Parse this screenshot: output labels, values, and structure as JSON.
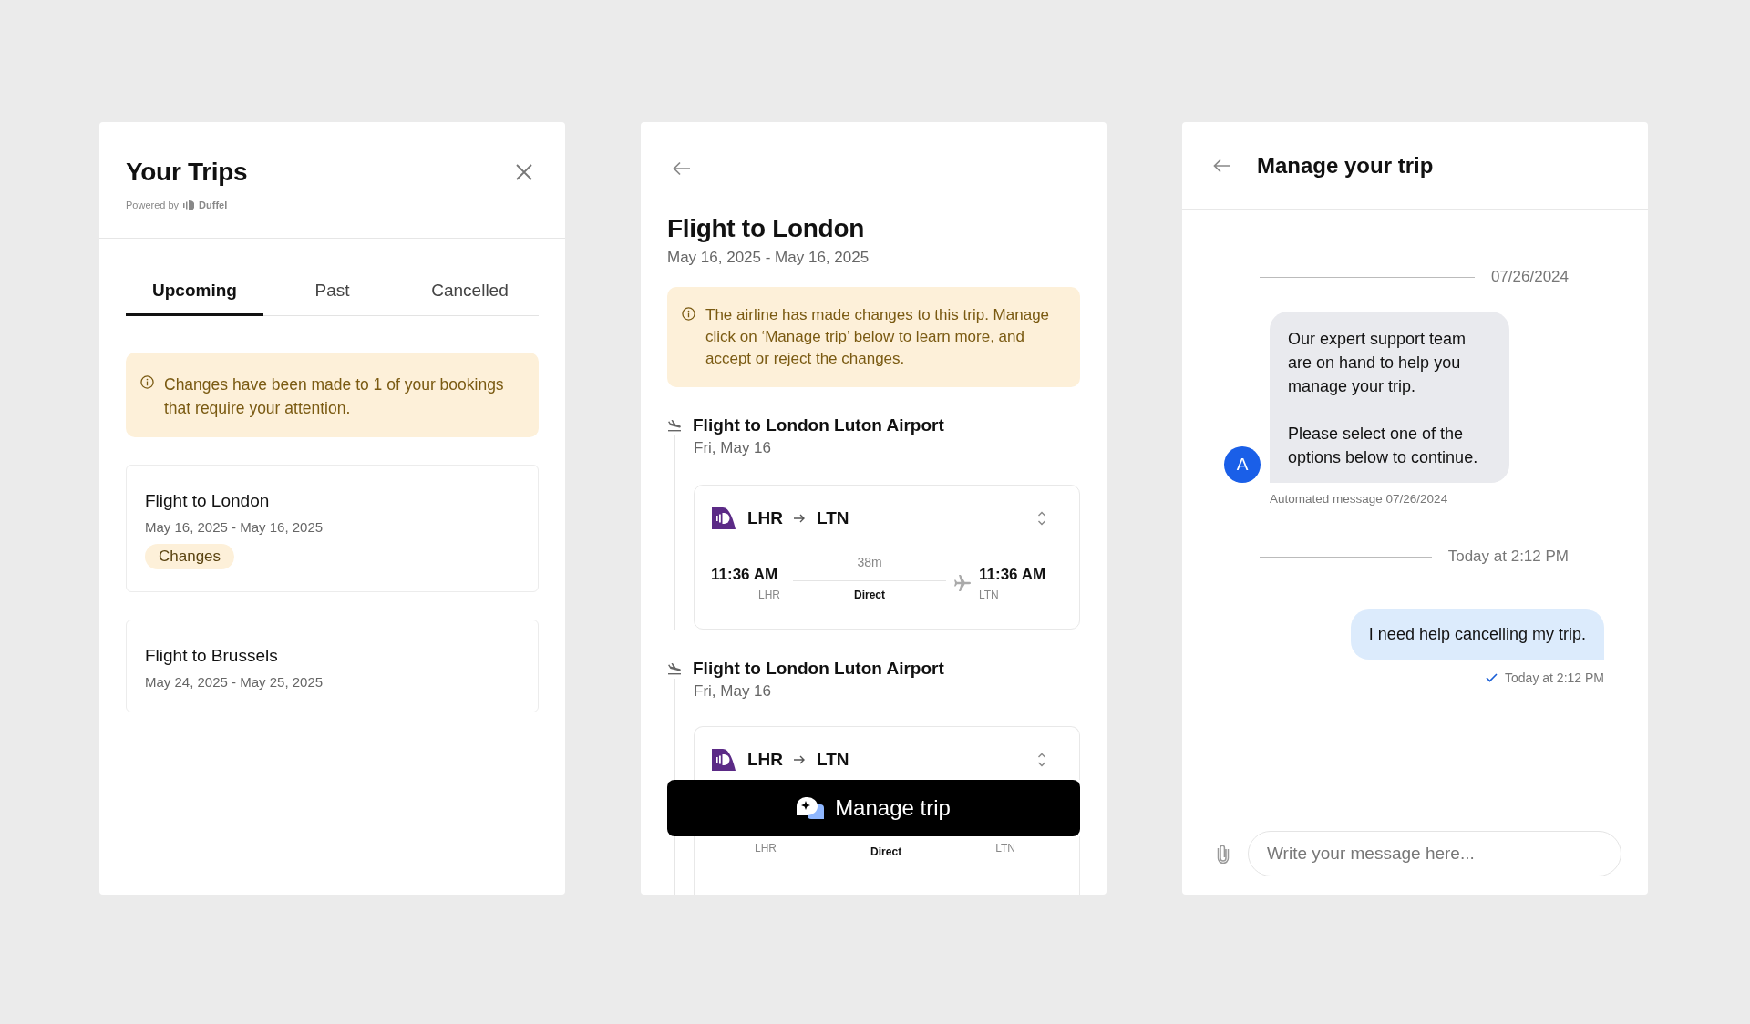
{
  "trips_panel": {
    "title": "Your Trips",
    "powered_by": "Powered by",
    "brand": "Duffel",
    "tabs": [
      {
        "label": "Upcoming",
        "selected": true
      },
      {
        "label": "Past",
        "selected": false
      },
      {
        "label": "Cancelled",
        "selected": false
      }
    ],
    "alert": "Changes have been made to 1 of your bookings that require your attention.",
    "trips": [
      {
        "title": "Flight to London",
        "dates": "May 16, 2025 - May 16, 2025",
        "badge": "Changes"
      },
      {
        "title": "Flight to Brussels",
        "dates": "May 24, 2025 - May 25, 2025"
      }
    ]
  },
  "trip_panel": {
    "title": "Flight to London",
    "dates": "May 16, 2025 - May 16, 2025",
    "alert": "The airline has made changes to this trip. Manage click on ‘Manage trip’ below to learn more, and accept or reject the changes.",
    "segments": [
      {
        "title": "Flight to London Luton Airport",
        "date": "Fri, May 16",
        "origin": "LHR",
        "destination": "LTN",
        "departure_time": "11:36 AM",
        "departure_code": "LHR",
        "arrival_time": "11:36 AM",
        "arrival_code": "LTN",
        "duration": "38m",
        "stops": "Direct"
      }
    ],
    "last_segment": {
      "title": "Flight to London Luton Airport",
      "date": "Fri, May 16",
      "origin": "LHR",
      "destination": "LTN",
      "departure_code": "LHR",
      "arrival_code": "LTN",
      "stops": "Direct"
    },
    "button": "Manage trip"
  },
  "chat_panel": {
    "title": "Manage your trip",
    "messages": [
      {
        "kind": "divider",
        "text": "07/26/2024"
      },
      {
        "kind": "incoming",
        "avatar": "A",
        "paragraphs": [
          "Our expert support team are on hand to help you manage your trip.",
          "Please select one of the options below to continue."
        ],
        "meta": "Automated message 07/26/2024"
      },
      {
        "kind": "divider",
        "text": "Today at 2:12 PM"
      },
      {
        "kind": "outgoing",
        "text": "I need help cancelling my trip.",
        "meta": "Today at 2:12 PM",
        "delivered": true
      }
    ],
    "input": {
      "placeholder": "Write your message here..."
    }
  }
}
